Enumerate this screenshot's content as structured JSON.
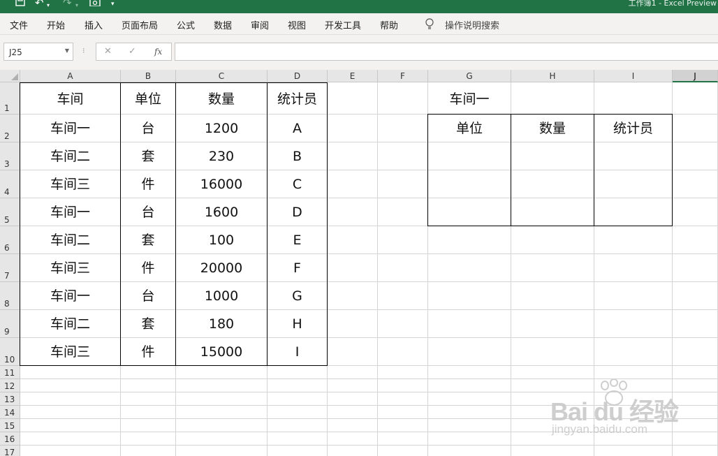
{
  "window": {
    "title": "工作簿1 - Excel Preview"
  },
  "ribbon": {
    "tabs": [
      "文件",
      "开始",
      "插入",
      "页面布局",
      "公式",
      "数据",
      "审阅",
      "视图",
      "开发工具",
      "帮助"
    ],
    "tell_me": "操作说明搜索"
  },
  "formula_bar": {
    "name_box": "J25",
    "fx_label": "fx",
    "formula": ""
  },
  "grid": {
    "columns": [
      "A",
      "B",
      "C",
      "D",
      "E",
      "F",
      "G",
      "H",
      "I",
      "J"
    ],
    "rows": [
      "1",
      "2",
      "3",
      "4",
      "5",
      "6",
      "7",
      "8",
      "9",
      "10",
      "11",
      "12",
      "13",
      "14",
      "15",
      "16",
      "17"
    ],
    "selected_column": "J"
  },
  "source_table": {
    "headers": [
      "车间",
      "单位",
      "数量",
      "统计员"
    ],
    "rows": [
      [
        "车间一",
        "台",
        "1200",
        "A"
      ],
      [
        "车间二",
        "套",
        "230",
        "B"
      ],
      [
        "车间三",
        "件",
        "16000",
        "C"
      ],
      [
        "车间一",
        "台",
        "1600",
        "D"
      ],
      [
        "车间二",
        "套",
        "100",
        "E"
      ],
      [
        "车间三",
        "件",
        "20000",
        "F"
      ],
      [
        "车间一",
        "台",
        "1000",
        "G"
      ],
      [
        "车间二",
        "套",
        "180",
        "H"
      ],
      [
        "车间三",
        "件",
        "15000",
        "I"
      ]
    ]
  },
  "lookup_table": {
    "title": "车间一",
    "headers": [
      "单位",
      "数量",
      "统计员"
    ]
  },
  "watermark": {
    "logo": "Bai du 经验",
    "url": "jingyan.baidu.com"
  },
  "colors": {
    "accent": "#217346",
    "ribbon_bg": "#f3f2f1",
    "header_bg": "#e6e6e6"
  }
}
